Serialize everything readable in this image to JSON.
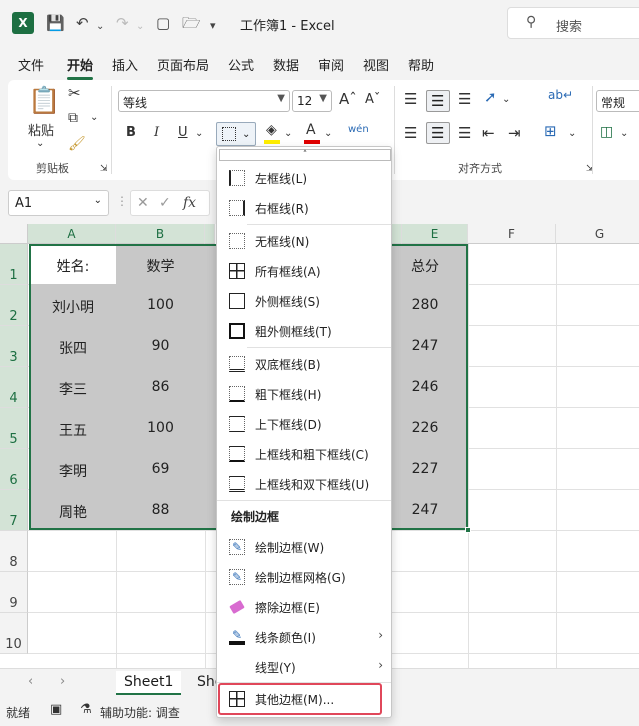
{
  "titlebar": {
    "title": "工作簿1  -  Excel",
    "search_placeholder": "搜索"
  },
  "menu": {
    "tabs": [
      "文件",
      "开始",
      "插入",
      "页面布局",
      "公式",
      "数据",
      "审阅",
      "视图",
      "帮助"
    ],
    "active": "开始"
  },
  "ribbon": {
    "paste_label": "粘贴",
    "clipboard_group": "剪贴板",
    "font_name": "等线",
    "font_size": "12",
    "bold": "B",
    "italic": "I",
    "underline": "U",
    "alignment_group": "对齐方式",
    "number_format": "常规"
  },
  "formula_bar": {
    "name_box": "A1",
    "fx": "fx"
  },
  "grid": {
    "columns": [
      "A",
      "B",
      "C",
      "D",
      "E",
      "F",
      "G"
    ],
    "rows": [
      "1",
      "2",
      "3",
      "4",
      "5",
      "6",
      "7",
      "8",
      "9",
      "10"
    ],
    "col_a": [
      "姓名:",
      "刘小明",
      "张四",
      "李三",
      "王五",
      "李明",
      "周艳"
    ],
    "col_b": [
      "数学",
      "100",
      "90",
      "86",
      "100",
      "69",
      "88"
    ],
    "col_e": [
      "总分",
      "280",
      "247",
      "246",
      "226",
      "227",
      "247"
    ]
  },
  "sheets": {
    "active": "Sheet1",
    "partial": "She"
  },
  "status": {
    "ready": "就绪",
    "accessibility": "辅助功能: 调查"
  },
  "border_menu": {
    "items": [
      {
        "label": "左框线(L)",
        "icon": "border-left-icon"
      },
      {
        "label": "右框线(R)",
        "icon": "border-right-icon"
      },
      {
        "label": "无框线(N)",
        "icon": "border-none-icon"
      },
      {
        "label": "所有框线(A)",
        "icon": "border-all-icon"
      },
      {
        "label": "外侧框线(S)",
        "icon": "border-outside-icon"
      },
      {
        "label": "粗外侧框线(T)",
        "icon": "border-thick-outside-icon"
      },
      {
        "label": "双底框线(B)",
        "icon": "border-double-bottom-icon"
      },
      {
        "label": "粗下框线(H)",
        "icon": "border-thick-bottom-icon"
      },
      {
        "label": "上下框线(D)",
        "icon": "border-top-bottom-icon"
      },
      {
        "label": "上框线和粗下框线(C)",
        "icon": "border-top-thick-bottom-icon"
      },
      {
        "label": "上框线和双下框线(U)",
        "icon": "border-top-double-bottom-icon"
      }
    ],
    "draw_heading": "绘制边框",
    "draw_items": [
      {
        "label": "绘制边框(W)",
        "icon": "draw-border-icon"
      },
      {
        "label": "绘制边框网格(G)",
        "icon": "draw-border-grid-icon"
      },
      {
        "label": "擦除边框(E)",
        "icon": "eraser-icon"
      },
      {
        "label": "线条颜色(I)",
        "icon": "line-color-icon"
      },
      {
        "label": "线型(Y)",
        "icon": "line-style-icon"
      },
      {
        "label": "其他边框(M)...",
        "icon": "more-borders-icon"
      }
    ],
    "highlight_color": "#e0475a"
  }
}
